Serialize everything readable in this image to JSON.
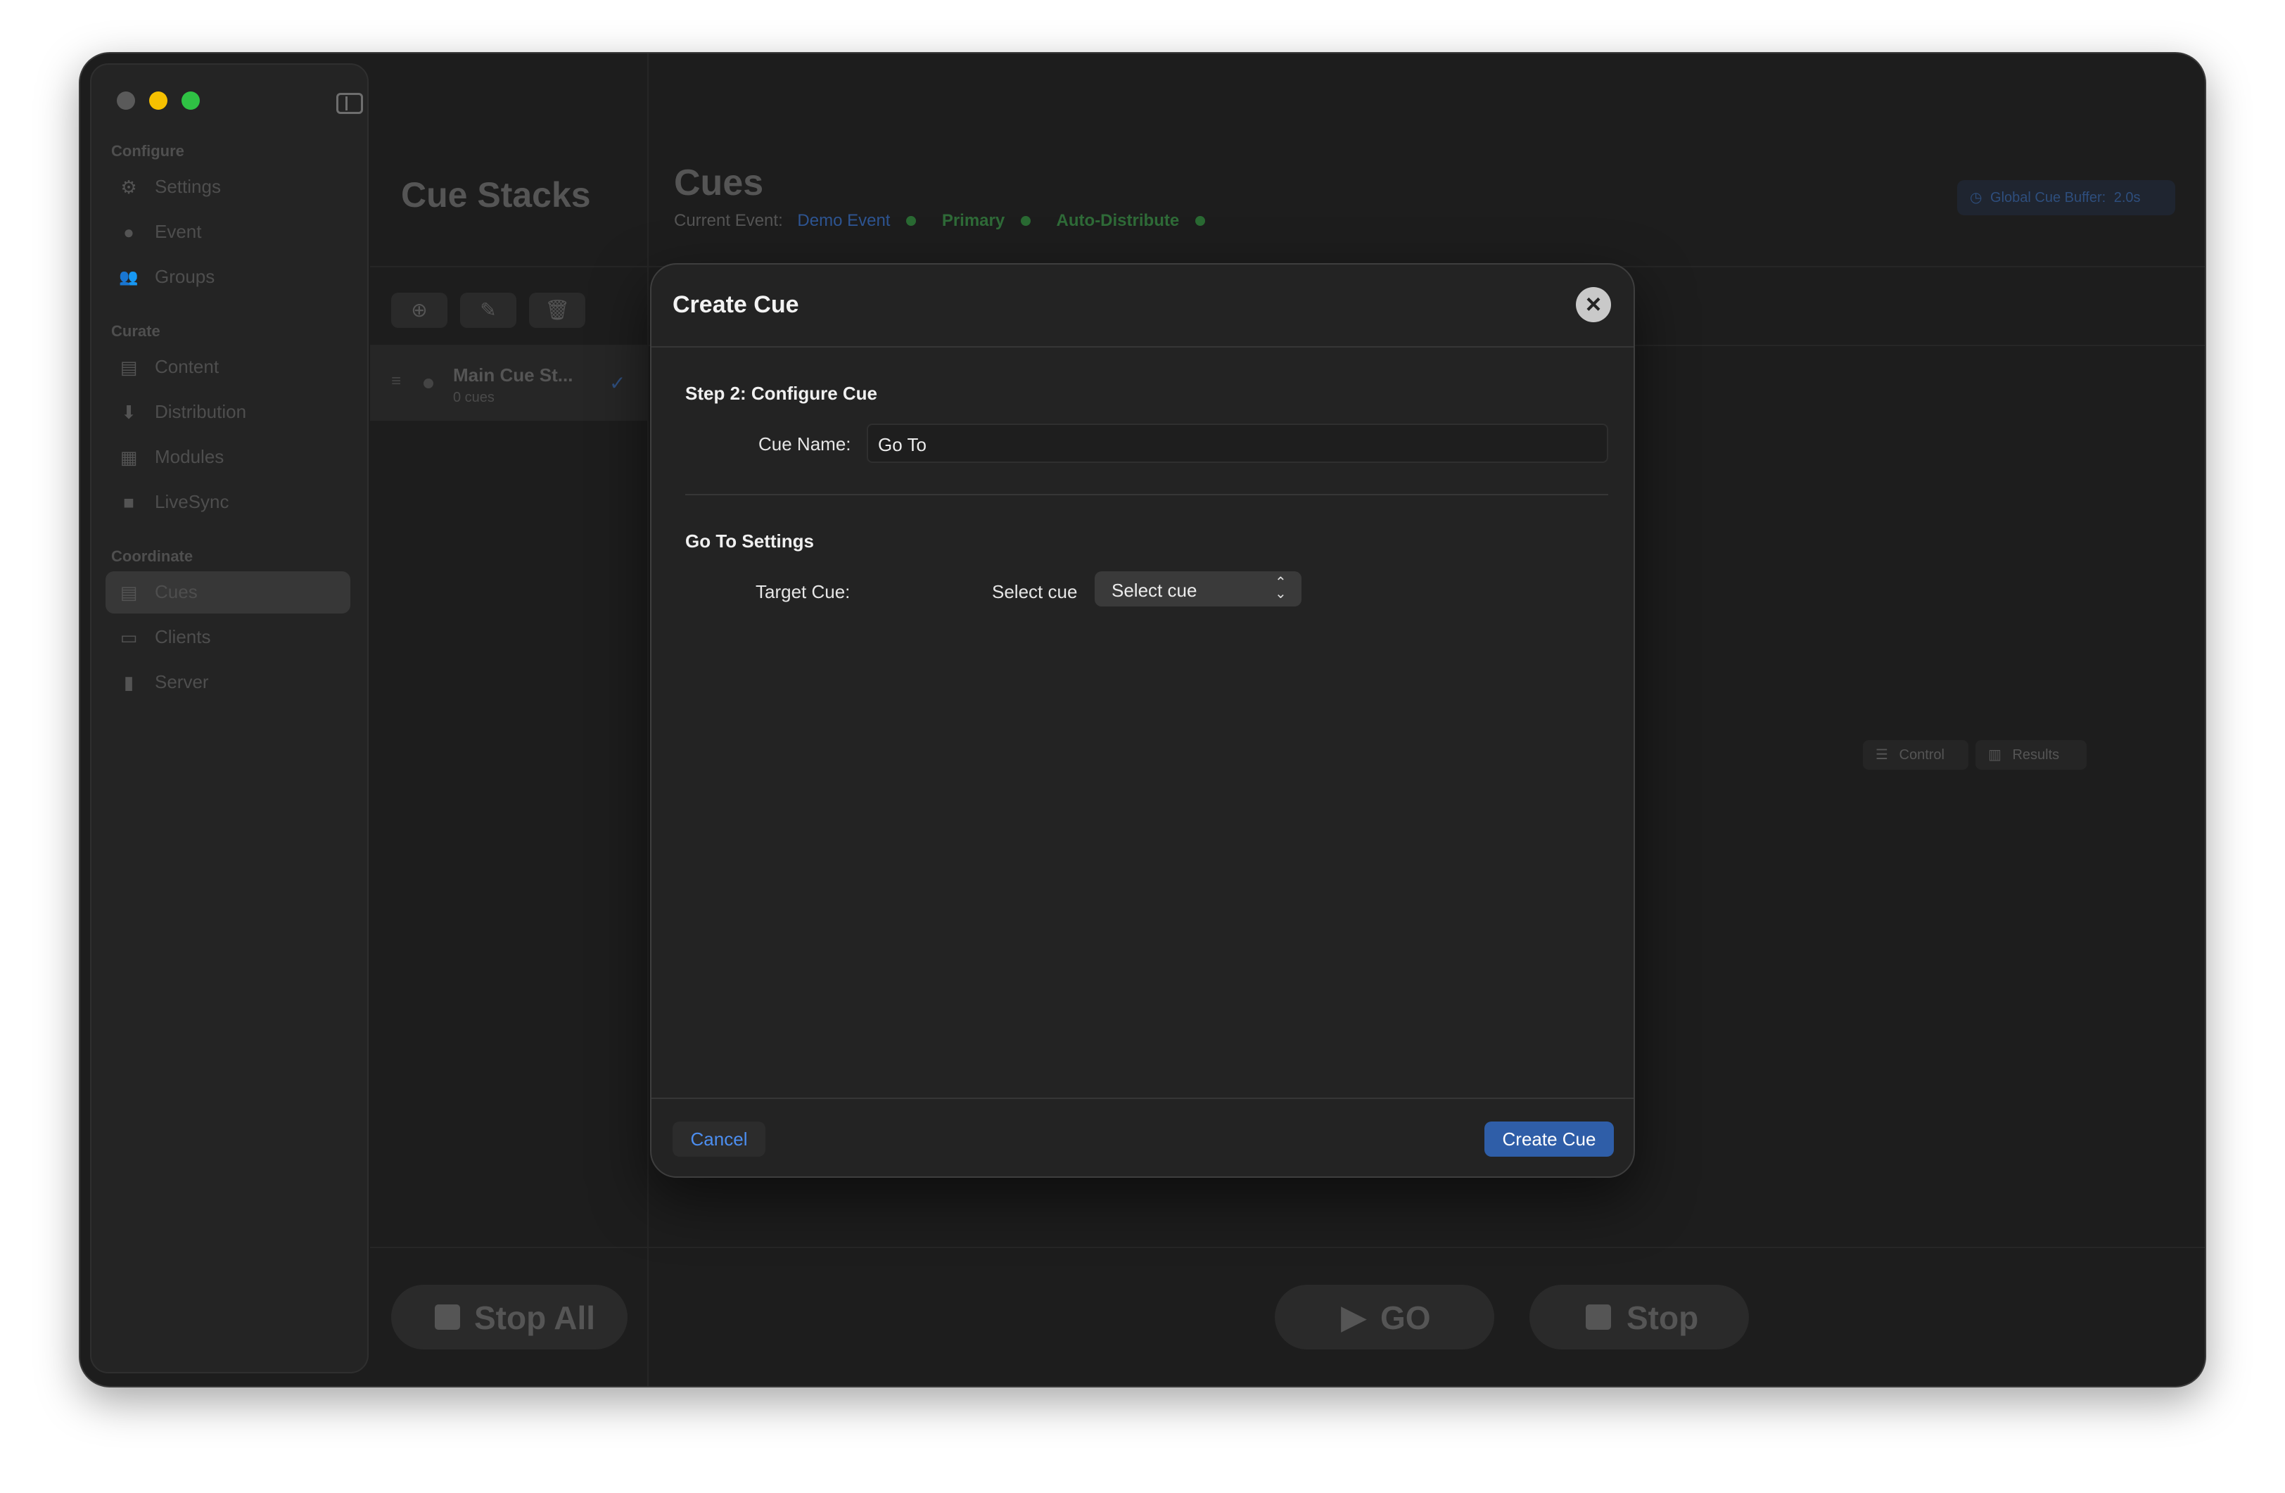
{
  "sidebar": {
    "sections": [
      {
        "label": "Configure",
        "items": [
          {
            "label": "Settings",
            "icon": "gear-icon"
          },
          {
            "label": "Event",
            "icon": "event-icon"
          },
          {
            "label": "Groups",
            "icon": "people-icon"
          }
        ]
      },
      {
        "label": "Curate",
        "items": [
          {
            "label": "Content",
            "icon": "content-icon"
          },
          {
            "label": "Distribution",
            "icon": "download-icon"
          },
          {
            "label": "Modules",
            "icon": "grid-icon"
          },
          {
            "label": "LiveSync",
            "icon": "camera-icon"
          }
        ]
      },
      {
        "label": "Coordinate",
        "items": [
          {
            "label": "Cues",
            "icon": "list-icon",
            "active": true
          },
          {
            "label": "Clients",
            "icon": "clients-icon"
          },
          {
            "label": "Server",
            "icon": "chart-bars-icon"
          }
        ]
      }
    ]
  },
  "stacks": {
    "title": "Cue Stacks",
    "row": {
      "name": "Main Cue St...",
      "count": "0 cues"
    },
    "stop_all": "Stop All"
  },
  "cues": {
    "title": "Cues",
    "current_event_label": "Current Event:",
    "current_event": "Demo Event",
    "primary": "Primary",
    "auto_distribute": "Auto-Distribute",
    "buffer_label": "Global Cue Buffer:",
    "buffer_value": "2.0s",
    "control": "Control",
    "results": "Results",
    "go": "GO",
    "stop": "Stop"
  },
  "colors": {
    "accent_blue": "#4c8ef0",
    "status_green": "#3fa34d",
    "primary_button": "#2f5ea8"
  },
  "modal": {
    "title": "Create Cue",
    "step_title": "Step 2: Configure Cue",
    "cue_name_label": "Cue Name:",
    "cue_name_value": "Go To",
    "settings_title": "Go To Settings",
    "target_cue_label": "Target Cue:",
    "select_cue_label": "Select cue",
    "select_cue_value": "Select cue",
    "cancel": "Cancel",
    "create": "Create Cue"
  }
}
